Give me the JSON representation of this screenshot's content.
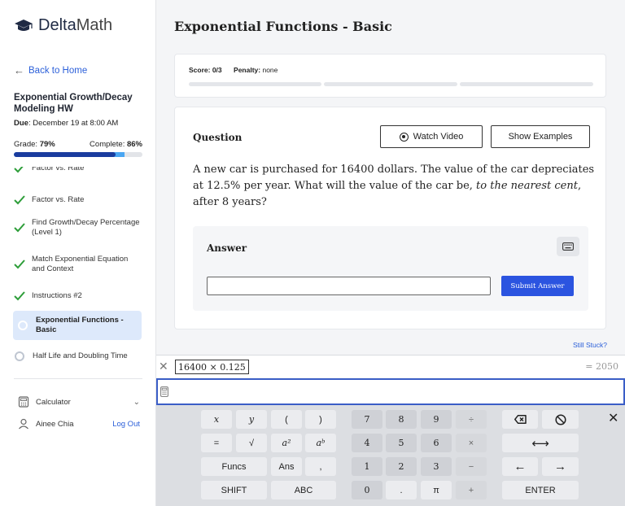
{
  "sidebar": {
    "logo_bold": "Delta",
    "logo_light": "Math",
    "back_label": "Back to Home",
    "hw_title": "Exponential Growth/Decay Modeling HW",
    "due_label": "Due",
    "due_value": ": December 19 at 8:00 AM",
    "grade_label": "Grade: ",
    "grade_value": "79%",
    "complete_label": "Complete: ",
    "complete_value": "86%",
    "grade_fraction": 0.79,
    "complete_fraction": 0.86,
    "tasks": [
      {
        "label": "Factor vs. Rate",
        "status": "done"
      },
      {
        "label": "Factor vs. Rate",
        "status": "done"
      },
      {
        "label": "Find Growth/Decay Percentage (Level 1)",
        "status": "done"
      },
      {
        "label": "Match Exponential Equation and Context",
        "status": "done"
      },
      {
        "label": "Instructions #2",
        "status": "done"
      },
      {
        "label": "Exponential Functions - Basic",
        "status": "current"
      },
      {
        "label": "Half Life and Doubling Time",
        "status": "todo"
      }
    ],
    "calculator_label": "Calculator",
    "user_name": "Ainee Chia",
    "logout_label": "Log Out"
  },
  "main": {
    "page_title": "Exponential Functions - Basic",
    "score_label": "Score:",
    "score_value": " 0/3",
    "penalty_label": "Penalty:",
    "penalty_value": " none",
    "question_label": "Question",
    "watch_video_label": "Watch Video",
    "show_examples_label": "Show Examples",
    "question_text_1": "A new car is purchased for 16400 dollars. The value of the car depreciates at 12.5% per year. What will the value of the car be, ",
    "question_text_em": "to the nearest cent",
    "question_text_2": ", after 8 years?",
    "answer_label": "Answer",
    "answer_value": "",
    "submit_label": "Submit Answer",
    "still_stuck_label": "Still Stuck?"
  },
  "calculator": {
    "expression": "16400 × 0.125",
    "result": "= 2050",
    "input_value": ""
  },
  "keypad": {
    "keys": [
      "x",
      "y",
      "(",
      ")",
      "7",
      "8",
      "9",
      "÷",
      "=",
      "√",
      "a²",
      "aᵇ",
      "4",
      "5",
      "6",
      "×",
      "Funcs",
      "Ans",
      ",",
      "1",
      "2",
      "3",
      "−",
      "SHIFT",
      "ABC",
      "0",
      ".",
      "π",
      "+",
      "ENTER"
    ]
  },
  "colors": {
    "accent": "#2b54e0",
    "link": "#2b5fd9",
    "check": "#2e9e3a",
    "grade_bar": "#1a3c9e",
    "complete_bar": "#4aa6f2"
  }
}
